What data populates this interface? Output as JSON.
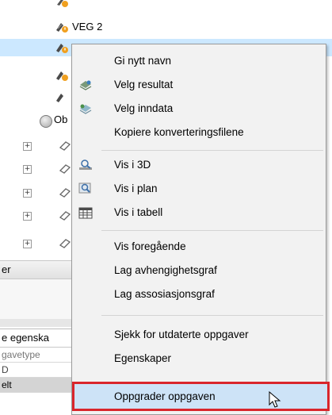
{
  "tree": {
    "items": [
      {
        "label": "VEG 2"
      },
      {
        "label": "VEG 2"
      },
      {
        "label": "Ob"
      }
    ]
  },
  "panels": {
    "top_header": "er",
    "bottom_header": "e egenska",
    "rows": [
      "gavetype",
      "D",
      "elt"
    ]
  },
  "context_menu": {
    "groups": [
      [
        {
          "label": "Gi nytt navn",
          "icon": null
        },
        {
          "label": "Velg resultat",
          "icon": "select-result-icon"
        },
        {
          "label": "Velg inndata",
          "icon": "select-input-icon"
        },
        {
          "label": "Kopiere konverteringsfilene",
          "icon": null
        }
      ],
      [
        {
          "label": "Vis i 3D",
          "icon": "view-3d-icon"
        },
        {
          "label": "Vis i plan",
          "icon": "view-plan-icon"
        },
        {
          "label": "Vis i tabell",
          "icon": "table-icon"
        }
      ],
      [
        {
          "label": "Vis foregående",
          "icon": null
        },
        {
          "label": "Lag avhengighetsgraf",
          "icon": null
        },
        {
          "label": "Lag assosiasjonsgraf",
          "icon": null
        }
      ],
      [
        {
          "label": "Sjekk for utdaterte oppgaver",
          "icon": null
        },
        {
          "label": "Egenskaper",
          "icon": null
        },
        {
          "label": "Oppgrader oppgaven",
          "icon": null
        }
      ]
    ],
    "highlight_color": "#d9262c"
  }
}
